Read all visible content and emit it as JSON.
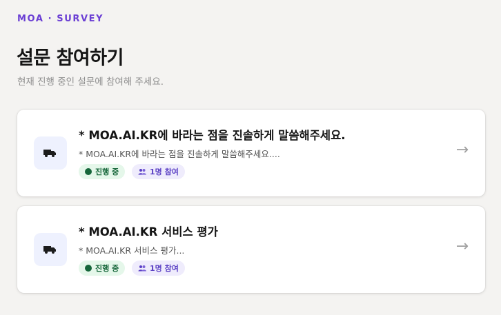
{
  "header": {
    "brand": "MOA · SURVEY",
    "title": "설문 참여하기",
    "subtitle": "현재 진행 중인 설문에 참여해 주세요."
  },
  "surveys": [
    {
      "icon": "truck-icon",
      "title": "* MOA.AI.KR에 바라는 점을 진솔하게 말씀해주세요.",
      "description": "* MOA.AI.KR에 바라는 점을 진솔하게 말씀해주세요....",
      "status": "진행 중",
      "participants": "1명 참여",
      "arrow": "→"
    },
    {
      "icon": "truck-icon",
      "title": "* MOA.AI.KR 서비스 평가",
      "description": "* MOA.AI.KR 서비스 평가...",
      "status": "진행 중",
      "participants": "1명 참여",
      "arrow": "→"
    }
  ],
  "colors": {
    "accent": "#6b3fd4",
    "status_green": "#16663a",
    "status_bg": "#e5f7ea",
    "count_bg": "#efecfc",
    "icon_bg": "#eef1fe"
  }
}
